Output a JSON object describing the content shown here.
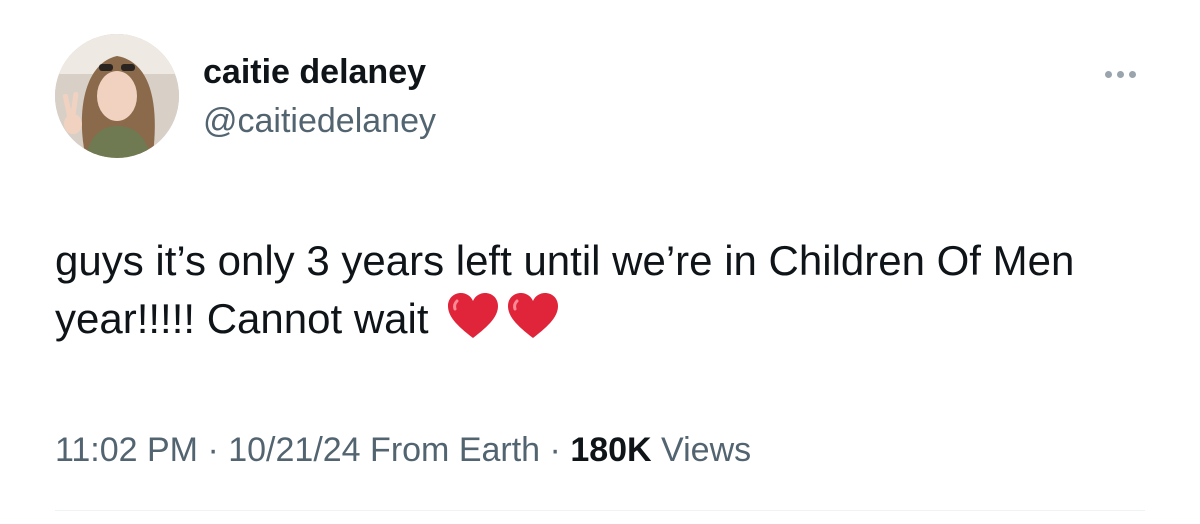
{
  "author": {
    "display_name": "caitie delaney",
    "handle": "@caitiedelaney",
    "avatar_icon": "profile-photo"
  },
  "tweet": {
    "text": "guys it’s only 3 years left until we’re in Children Of Men year!!!!! Cannot wait",
    "emojis": [
      "red-heart",
      "red-heart"
    ],
    "time": "11:02 PM",
    "separator": " · ",
    "date": "10/21/24",
    "source": "From Earth",
    "views_count": "180K",
    "views_label": "Views"
  },
  "colors": {
    "primary_text": "#0f1419",
    "secondary_text": "#536471",
    "heart": "#e0243a"
  },
  "more_menu_icon": "ellipsis-icon"
}
